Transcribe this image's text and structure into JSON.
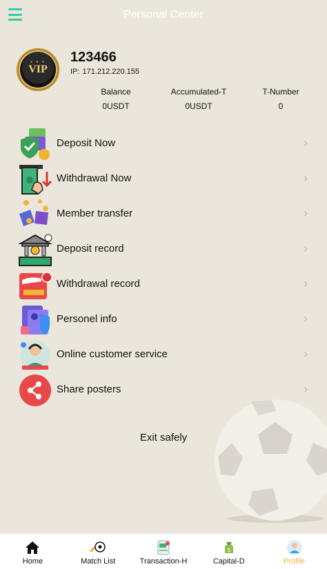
{
  "header": {
    "title": "Personal Center",
    "menu_icon": "hamburger-icon",
    "accent": "#3cc6a3"
  },
  "profile": {
    "vip_badge": "VIP",
    "username": "123466",
    "ip_label": "IP:",
    "ip_value": "171.212.220.155"
  },
  "stats": [
    {
      "label": "Balance",
      "value": "0USDT"
    },
    {
      "label": "Accumulated-T",
      "value": "0USDT"
    },
    {
      "label": "T-Number",
      "value": "0"
    }
  ],
  "menu": [
    {
      "label": "Deposit Now",
      "icon": "deposit-icon"
    },
    {
      "label": "Withdrawal Now",
      "icon": "withdrawal-icon"
    },
    {
      "label": "Member transfer",
      "icon": "transfer-icon"
    },
    {
      "label": "Deposit record",
      "icon": "bank-icon"
    },
    {
      "label": "Withdrawal record",
      "icon": "wallet-icon"
    },
    {
      "label": "Personel info",
      "icon": "profile-card-icon"
    },
    {
      "label": "Online customer service",
      "icon": "support-agent-icon"
    },
    {
      "label": "Share posters",
      "icon": "share-icon"
    }
  ],
  "exit_label": "Exit safely",
  "tabbar": {
    "active_color": "#f3b33b",
    "tabs": [
      {
        "label": "Home",
        "icon": "home-icon"
      },
      {
        "label": "Match List",
        "icon": "ball-icon"
      },
      {
        "label": "Transaction-H",
        "icon": "transaction-icon"
      },
      {
        "label": "Capital-D",
        "icon": "money-bag-icon"
      },
      {
        "label": "Profile",
        "icon": "person-icon"
      }
    ]
  }
}
